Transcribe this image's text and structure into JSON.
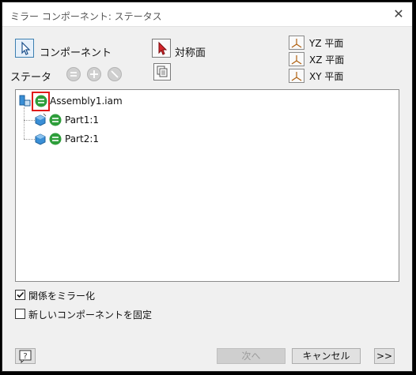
{
  "window": {
    "title": "ミラー コンポーネント: ステータス"
  },
  "selection": {
    "component_label": "コンポーネント",
    "mirror_plane_label": "対称面"
  },
  "planes": [
    {
      "label": "YZ 平面"
    },
    {
      "label": "XZ 平面"
    },
    {
      "label": "XY 平面"
    }
  ],
  "status": {
    "label": "ステータ"
  },
  "tree": {
    "root": {
      "label": "Assembly1.iam"
    },
    "children": [
      {
        "label": "Part1:1"
      },
      {
        "label": "Part2:1"
      }
    ]
  },
  "options": [
    {
      "label": "関係をミラー化",
      "checked": true
    },
    {
      "label": "新しいコンポーネントを固定",
      "checked": false
    }
  ],
  "footer": {
    "next_label": "次へ",
    "cancel_label": "キャンセル",
    "expand_label": ">>"
  },
  "colors": {
    "status_green": "#2e9e3b",
    "highlight_red": "#e11a1a",
    "part_blue": "#3a8fd6"
  }
}
